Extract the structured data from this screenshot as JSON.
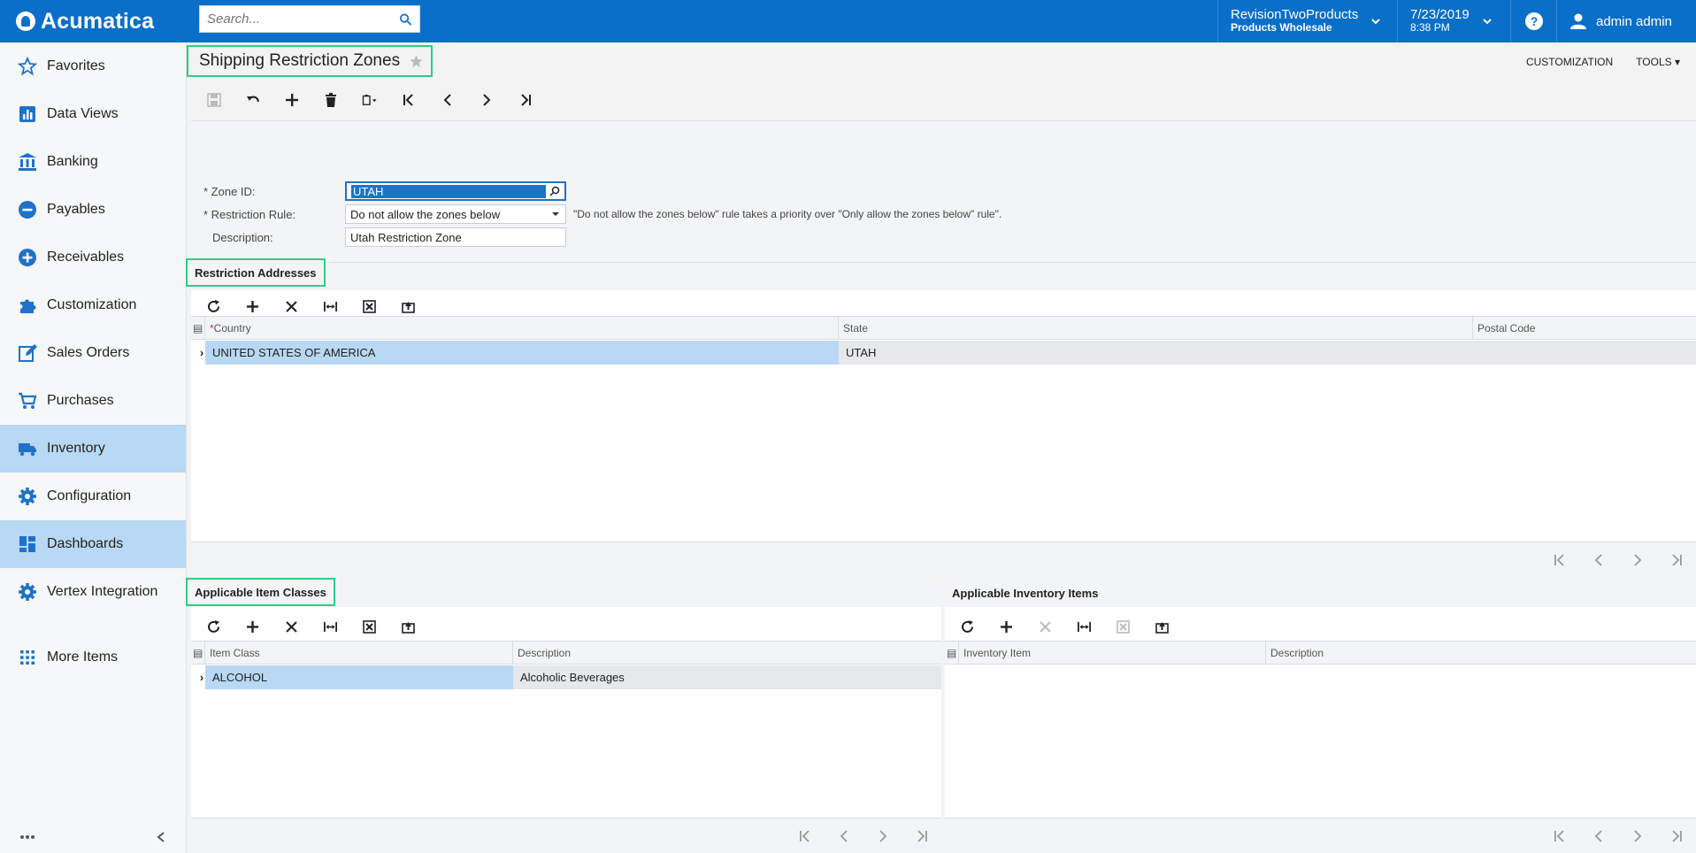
{
  "app": {
    "logo": "Acumatica",
    "search_placeholder": "Search...",
    "company_line1": "RevisionTwoProducts",
    "company_line2": "Products Wholesale",
    "date": "7/23/2019",
    "time": "8:38 PM",
    "user": "admin admin"
  },
  "sidebar": {
    "items": [
      {
        "label": "Favorites",
        "icon": "star-icon"
      },
      {
        "label": "Data Views",
        "icon": "bar-chart-icon"
      },
      {
        "label": "Banking",
        "icon": "bank-icon"
      },
      {
        "label": "Payables",
        "icon": "minus-circle-icon"
      },
      {
        "label": "Receivables",
        "icon": "plus-circle-icon"
      },
      {
        "label": "Customization",
        "icon": "puzzle-icon"
      },
      {
        "label": "Sales Orders",
        "icon": "edit-icon"
      },
      {
        "label": "Purchases",
        "icon": "cart-icon"
      },
      {
        "label": "Inventory",
        "icon": "truck-icon"
      },
      {
        "label": "Configuration",
        "icon": "gear-icon"
      },
      {
        "label": "Dashboards",
        "icon": "dashboard-icon"
      },
      {
        "label": "Vertex Integration",
        "icon": "gear-icon"
      }
    ],
    "more_label": "More Items",
    "active": [
      "Inventory",
      "Dashboards"
    ]
  },
  "page": {
    "title": "Shipping Restriction Zones",
    "links": [
      "CUSTOMIZATION",
      "TOOLS"
    ]
  },
  "form": {
    "zone_id_label": "Zone ID:",
    "zone_id_value": "UTAH",
    "rule_label": "Restriction Rule:",
    "rule_value": "Do not allow the zones below",
    "rule_note": "\"Do not allow the zones below\" rule takes a priority over \"Only allow the zones below\" rule\".",
    "description_label": "Description:",
    "description_value": "Utah Restriction Zone"
  },
  "restriction_addresses": {
    "title": "Restriction Addresses",
    "columns": [
      "Country",
      "State",
      "Postal Code"
    ],
    "rows": [
      {
        "country": "UNITED STATES OF AMERICA",
        "state": "UTAH",
        "postal": ""
      }
    ]
  },
  "item_classes": {
    "title": "Applicable Item Classes",
    "columns": [
      "Item Class",
      "Description"
    ],
    "rows": [
      {
        "item_class": "ALCOHOL",
        "description": "Alcoholic Beverages"
      }
    ]
  },
  "inventory_items": {
    "title": "Applicable Inventory Items",
    "columns": [
      "Inventory Item",
      "Description"
    ]
  },
  "colors": {
    "topbar": "#0a6fc8",
    "highlight": "#2ecc8a",
    "selection": "#b9d8f3"
  }
}
